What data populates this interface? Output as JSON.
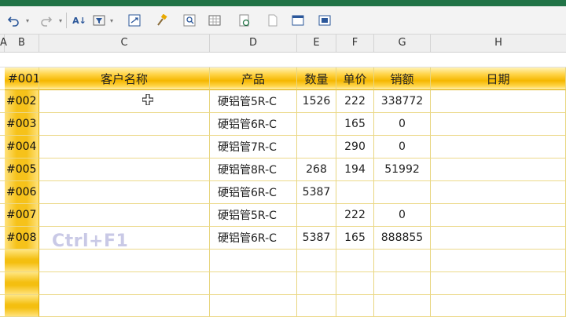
{
  "toolbar": {
    "icons": [
      "undo-icon",
      "redo-icon",
      "sort-icon",
      "filter-icon",
      "pivot-icon",
      "format-painter-icon",
      "find-icon",
      "table-icon",
      "refresh-icon",
      "copy-icon",
      "window-icon",
      "freeze-icon"
    ]
  },
  "columns": [
    "A",
    "B",
    "C",
    "D",
    "E",
    "F",
    "G",
    "H"
  ],
  "table": {
    "headers": [
      "#001",
      "客户名称",
      "产品",
      "数量",
      "单价",
      "销额",
      "日期"
    ],
    "rows": [
      {
        "id": "#002",
        "customer": "",
        "product": "硬铝管5R-C",
        "qty": "1526",
        "price": "222",
        "sales": "338772",
        "date": ""
      },
      {
        "id": "#003",
        "customer": "",
        "product": "硬铝管6R-C",
        "qty": "",
        "price": "165",
        "sales": "0",
        "date": ""
      },
      {
        "id": "#004",
        "customer": "",
        "product": "硬铝管7R-C",
        "qty": "",
        "price": "290",
        "sales": "0",
        "date": ""
      },
      {
        "id": "#005",
        "customer": "",
        "product": "硬铝管8R-C",
        "qty": "268",
        "price": "194",
        "sales": "51992",
        "date": ""
      },
      {
        "id": "#006",
        "customer": "",
        "product": "硬铝管6R-C",
        "qty": "5387",
        "price": "",
        "sales": "",
        "date": ""
      },
      {
        "id": "#007",
        "customer": "",
        "product": "硬铝管5R-C",
        "qty": "",
        "price": "222",
        "sales": "0",
        "date": ""
      },
      {
        "id": "#008",
        "customer": "",
        "product": "硬铝管6R-C",
        "qty": "5387",
        "price": "165",
        "sales": "888855",
        "date": ""
      }
    ]
  },
  "overlay": {
    "shortcut": "Ctrl+F1"
  },
  "colors": {
    "header_gold": "#f5b700",
    "excel_green": "#217346",
    "grid_line": "#ecd98a"
  }
}
